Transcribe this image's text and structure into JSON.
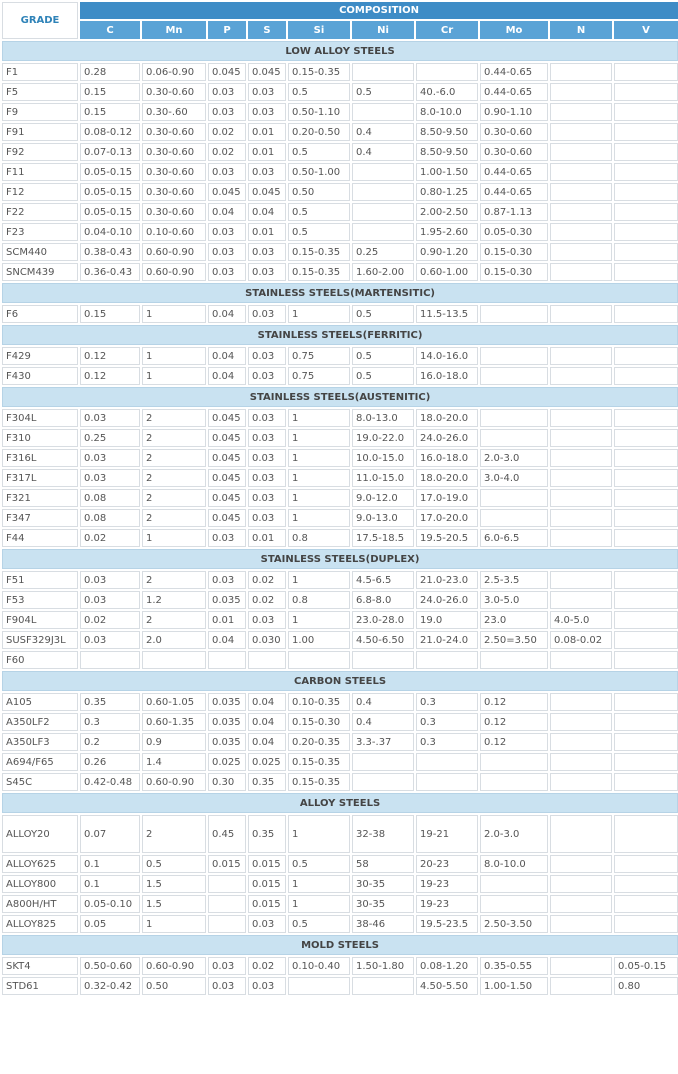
{
  "header": {
    "grade": "GRADE",
    "composition": "COMPOSITION",
    "elements": [
      "C",
      "Mn",
      "P",
      "S",
      "Si",
      "Ni",
      "Cr",
      "Mo",
      "N",
      "V"
    ]
  },
  "sections": [
    {
      "title": "LOW ALLOY STEELS",
      "rows": [
        [
          "F1",
          "0.28",
          "0.06-0.90",
          "0.045",
          "0.045",
          "0.15-0.35",
          "",
          "",
          "0.44-0.65",
          "",
          ""
        ],
        [
          "F5",
          "0.15",
          "0.30-0.60",
          "0.03",
          "0.03",
          "0.5",
          "0.5",
          "40.-6.0",
          "0.44-0.65",
          "",
          ""
        ],
        [
          "F9",
          "0.15",
          "0.30-.60",
          "0.03",
          "0.03",
          "0.50-1.10",
          "",
          "8.0-10.0",
          "0.90-1.10",
          "",
          ""
        ],
        [
          "F91",
          "0.08-0.12",
          "0.30-0.60",
          "0.02",
          "0.01",
          "0.20-0.50",
          "0.4",
          "8.50-9.50",
          "0.30-0.60",
          "",
          ""
        ],
        [
          "F92",
          "0.07-0.13",
          "0.30-0.60",
          "0.02",
          "0.01",
          "0.5",
          "0.4",
          "8.50-9.50",
          "0.30-0.60",
          "",
          ""
        ],
        [
          "F11",
          "0.05-0.15",
          "0.30-0.60",
          "0.03",
          "0.03",
          "0.50-1.00",
          "",
          "1.00-1.50",
          "0.44-0.65",
          "",
          ""
        ],
        [
          "F12",
          "0.05-0.15",
          "0.30-0.60",
          "0.045",
          "0.045",
          "0.50",
          "",
          "0.80-1.25",
          "0.44-0.65",
          "",
          ""
        ],
        [
          "F22",
          "0.05-0.15",
          "0.30-0.60",
          "0.04",
          "0.04",
          "0.5",
          "",
          "2.00-2.50",
          "0.87-1.13",
          "",
          ""
        ],
        [
          "F23",
          "0.04-0.10",
          "0.10-0.60",
          "0.03",
          "0.01",
          "0.5",
          "",
          "1.95-2.60",
          "0.05-0.30",
          "",
          ""
        ],
        [
          "SCM440",
          "0.38-0.43",
          "0.60-0.90",
          "0.03",
          "0.03",
          "0.15-0.35",
          "0.25",
          "0.90-1.20",
          "0.15-0.30",
          "",
          ""
        ],
        [
          "SNCM439",
          "0.36-0.43",
          "0.60-0.90",
          "0.03",
          "0.03",
          "0.15-0.35",
          "1.60-2.00",
          "0.60-1.00",
          "0.15-0.30",
          "",
          ""
        ]
      ]
    },
    {
      "title": "STAINLESS STEELS(MARTENSITIC)",
      "rows": [
        [
          "F6",
          "0.15",
          "1",
          "0.04",
          "0.03",
          "1",
          "0.5",
          "11.5-13.5",
          "",
          "",
          ""
        ]
      ]
    },
    {
      "title": "STAINLESS STEELS(FERRITIC)",
      "rows": [
        [
          "F429",
          "0.12",
          "1",
          "0.04",
          "0.03",
          "0.75",
          "0.5",
          "14.0-16.0",
          "",
          "",
          ""
        ],
        [
          "F430",
          "0.12",
          "1",
          "0.04",
          "0.03",
          "0.75",
          "0.5",
          "16.0-18.0",
          "",
          "",
          ""
        ]
      ]
    },
    {
      "title": "STAINLESS STEELS(AUSTENITIC)",
      "rows": [
        [
          "F304L",
          "0.03",
          "2",
          "0.045",
          "0.03",
          "1",
          "8.0-13.0",
          "18.0-20.0",
          "",
          "",
          ""
        ],
        [
          "F310",
          "0.25",
          "2",
          "0.045",
          "0.03",
          "1",
          "19.0-22.0",
          "24.0-26.0",
          "",
          "",
          ""
        ],
        [
          "F316L",
          "0.03",
          "2",
          "0.045",
          "0.03",
          "1",
          "10.0-15.0",
          "16.0-18.0",
          "2.0-3.0",
          "",
          ""
        ],
        [
          "F317L",
          "0.03",
          "2",
          "0.045",
          "0.03",
          "1",
          "11.0-15.0",
          "18.0-20.0",
          "3.0-4.0",
          "",
          ""
        ],
        [
          "F321",
          "0.08",
          "2",
          "0.045",
          "0.03",
          "1",
          "9.0-12.0",
          "17.0-19.0",
          "",
          "",
          ""
        ],
        [
          "F347",
          "0.08",
          "2",
          "0.045",
          "0.03",
          "1",
          "9.0-13.0",
          "17.0-20.0",
          "",
          "",
          ""
        ],
        [
          "F44",
          "0.02",
          "1",
          "0.03",
          "0.01",
          "0.8",
          "17.5-18.5",
          "19.5-20.5",
          "6.0-6.5",
          "",
          ""
        ]
      ]
    },
    {
      "title": "STAINLESS STEELS(DUPLEX)",
      "rows": [
        [
          "F51",
          "0.03",
          "2",
          "0.03",
          "0.02",
          "1",
          "4.5-6.5",
          "21.0-23.0",
          "2.5-3.5",
          "",
          ""
        ],
        [
          "F53",
          "0.03",
          "1.2",
          "0.035",
          "0.02",
          "0.8",
          "6.8-8.0",
          "24.0-26.0",
          "3.0-5.0",
          "",
          ""
        ],
        [
          "F904L",
          "0.02",
          "2",
          "0.01",
          "0.03",
          "1",
          "23.0-28.0",
          "19.0",
          "23.0",
          "4.0-5.0",
          ""
        ],
        [
          "SUSF329J3L",
          "0.03",
          "2.0",
          "0.04",
          "0.030",
          "1.00",
          "4.50-6.50",
          "21.0-24.0",
          "2.50=3.50",
          "0.08-0.02",
          ""
        ],
        [
          "F60",
          "",
          "",
          "",
          "",
          "",
          "",
          "",
          "",
          "",
          ""
        ]
      ]
    },
    {
      "title": "CARBON STEELS",
      "rows": [
        [
          "A105",
          "0.35",
          "0.60-1.05",
          "0.035",
          "0.04",
          "0.10-0.35",
          "0.4",
          "0.3",
          "0.12",
          "",
          ""
        ],
        [
          "A350LF2",
          "0.3",
          "0.60-1.35",
          "0.035",
          "0.04",
          "0.15-0.30",
          "0.4",
          "0.3",
          "0.12",
          "",
          ""
        ],
        [
          "A350LF3",
          "0.2",
          "0.9",
          "0.035",
          "0.04",
          "0.20-0.35",
          "3.3-.37",
          "0.3",
          "0.12",
          "",
          ""
        ],
        [
          "A694/F65",
          "0.26",
          "1.4",
          "0.025",
          "0.025",
          "0.15-0.35",
          "",
          "",
          "",
          "",
          ""
        ],
        [
          "S45C",
          "0.42-0.48",
          "0.60-0.90",
          "0.30",
          "0.35",
          "0.15-0.35",
          "",
          "",
          "",
          "",
          ""
        ]
      ]
    },
    {
      "title": "ALLOY STEELS",
      "rows": [
        [
          "ALLOY20",
          "0.07",
          "2",
          "0.45",
          "0.35",
          "1",
          "32-38",
          "19-21",
          "2.0-3.0",
          "",
          ""
        ],
        [
          "ALLOY625",
          "0.1",
          "0.5",
          "0.015",
          "0.015",
          "0.5",
          "58",
          "20-23",
          "8.0-10.0",
          "",
          ""
        ],
        [
          "ALLOY800",
          "0.1",
          "1.5",
          "",
          "0.015",
          "1",
          "30-35",
          "19-23",
          "",
          "",
          ""
        ],
        [
          "A800H/HT",
          "0.05-0.10",
          "1.5",
          "",
          "0.015",
          "1",
          "30-35",
          "19-23",
          "",
          "",
          ""
        ],
        [
          "ALLOY825",
          "0.05",
          "1",
          "",
          "0.03",
          "0.5",
          "38-46",
          "19.5-23.5",
          "2.50-3.50",
          "",
          ""
        ]
      ]
    },
    {
      "title": "MOLD STEELS",
      "rows": [
        [
          "SKT4",
          "0.50-0.60",
          "0.60-0.90",
          "0.03",
          "0.02",
          "0.10-0.40",
          "1.50-1.80",
          "0.08-1.20",
          "0.35-0.55",
          "",
          "0.05-0.15"
        ],
        [
          "STD61",
          "0.32-0.42",
          "0.50",
          "0.03",
          "0.03",
          "",
          "",
          "4.50-5.50",
          "1.00-1.50",
          "",
          "0.80"
        ]
      ]
    }
  ]
}
